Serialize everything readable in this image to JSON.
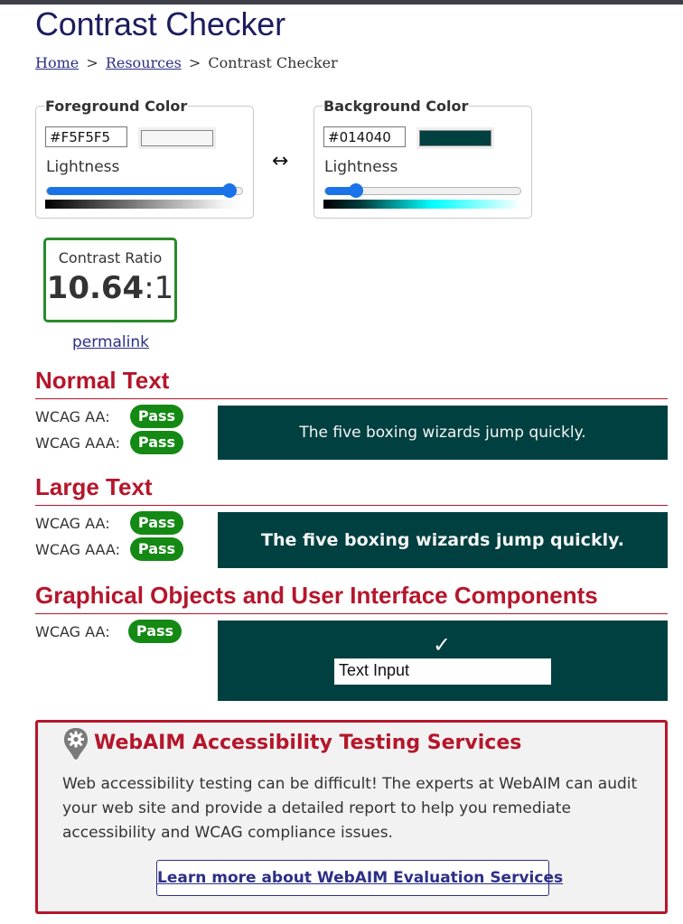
{
  "page": {
    "title": "Contrast Checker",
    "breadcrumb": {
      "home": "Home",
      "separator": ">",
      "resources": "Resources",
      "current": "Contrast Checker"
    }
  },
  "foreground": {
    "legend": "Foreground Color",
    "hex_value": "#F5F5F5",
    "swatch_color": "#F5F5F5",
    "lightness_label": "Lightness",
    "lightness_level": 0.96
  },
  "background": {
    "legend": "Background Color",
    "hex_value": "#014040",
    "swatch_color": "#014040",
    "lightness_label": "Lightness",
    "lightness_level": 0.13
  },
  "swap_icon": "left-right-arrow-icon",
  "contrast": {
    "label": "Contrast Ratio",
    "value": "10.64",
    "suffix": ":1",
    "permalink": "permalink"
  },
  "sections": {
    "normal": {
      "heading": "Normal Text",
      "aa_label": "WCAG AA:",
      "aa_result": "Pass",
      "aaa_label": "WCAG AAA:",
      "aaa_result": "Pass",
      "sample": "The five boxing wizards jump quickly."
    },
    "large": {
      "heading": "Large Text",
      "aa_label": "WCAG AA:",
      "aa_result": "Pass",
      "aaa_label": "WCAG AAA:",
      "aaa_result": "Pass",
      "sample": "The five boxing wizards jump quickly."
    },
    "graphical": {
      "heading": "Graphical Objects and User Interface Components",
      "aa_label": "WCAG AA:",
      "aa_result": "Pass",
      "checkmark": "✓",
      "text_input_value": "Text Input"
    }
  },
  "promo": {
    "icon": "gear-badge-icon",
    "title": "WebAIM Accessibility Testing Services",
    "text": "Web accessibility testing can be difficult! The experts at WebAIM can audit your web site and provide a detailed report to help you remediate accessibility and WCAG compliance issues.",
    "button": "Learn more about WebAIM Evaluation Services"
  },
  "colors": {
    "heading_blue": "#1c1c5e",
    "link_blue": "#2c2f87",
    "accent_red": "#b5162b",
    "pass_green": "#148a14",
    "slider_blue": "#1a73e8",
    "sample_bg": "#014040",
    "sample_fg": "#F5F5F5"
  }
}
